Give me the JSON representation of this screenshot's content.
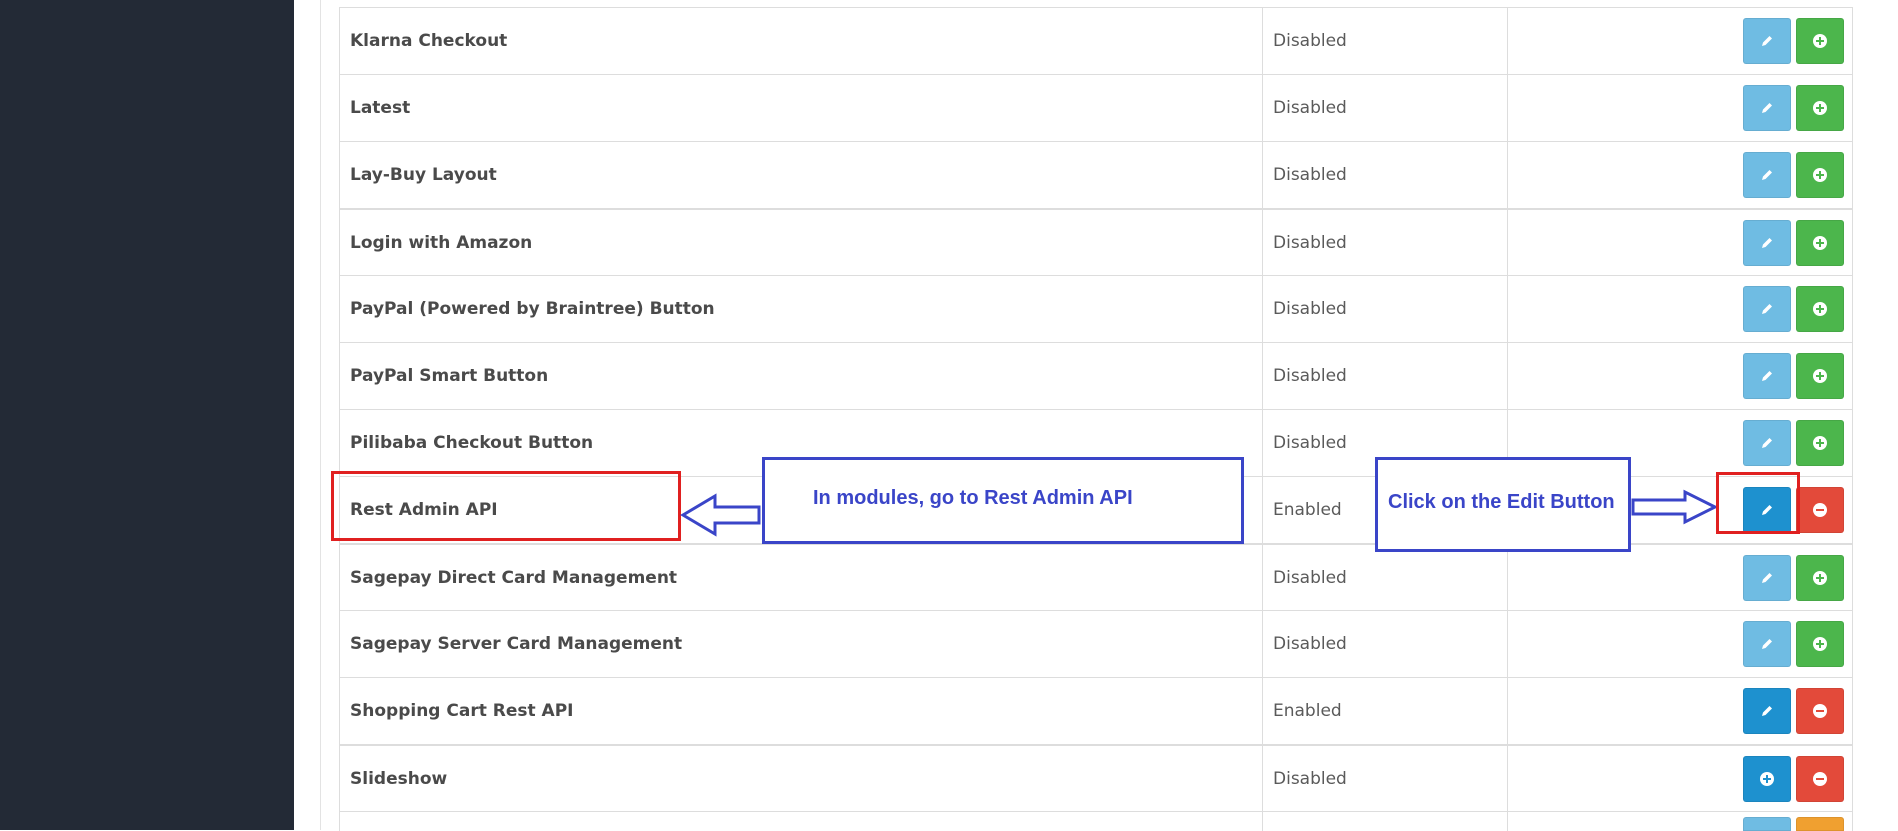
{
  "modules": [
    {
      "name": "Klarna Checkout",
      "status": "Disabled",
      "actions": [
        "edit-dim",
        "install"
      ]
    },
    {
      "name": "Latest",
      "status": "Disabled",
      "actions": [
        "edit-dim",
        "install"
      ]
    },
    {
      "name": "Lay-Buy Layout",
      "status": "Disabled",
      "actions": [
        "edit-dim",
        "install"
      ]
    },
    {
      "name": "Login with Amazon",
      "status": "Disabled",
      "actions": [
        "edit-dim",
        "install"
      ]
    },
    {
      "name": "PayPal (Powered by Braintree) Button",
      "status": "Disabled",
      "actions": [
        "edit-dim",
        "install"
      ]
    },
    {
      "name": "PayPal Smart Button",
      "status": "Disabled",
      "actions": [
        "edit-dim",
        "install"
      ]
    },
    {
      "name": "Pilibaba Checkout Button",
      "status": "Disabled",
      "actions": [
        "edit-dim",
        "install"
      ]
    },
    {
      "name": "Rest Admin API",
      "status": "Enabled",
      "actions": [
        "edit",
        "uninstall"
      ]
    },
    {
      "name": "Sagepay Direct Card Management",
      "status": "Disabled",
      "actions": [
        "edit-dim",
        "install"
      ]
    },
    {
      "name": "Sagepay Server Card Management",
      "status": "Disabled",
      "actions": [
        "edit-dim",
        "install"
      ]
    },
    {
      "name": "Shopping Cart Rest API",
      "status": "Enabled",
      "actions": [
        "edit",
        "uninstall"
      ]
    },
    {
      "name": "Slideshow",
      "status": "Disabled",
      "actions": [
        "install-blue",
        "uninstall"
      ]
    }
  ],
  "annotations": {
    "modules_hint": "In modules, go to Rest Admin API",
    "edit_hint": "Click on the Edit Button"
  },
  "colors": {
    "sidebar": "#232a36",
    "annotation_blue": "#3a45c8",
    "annotation_red": "#e02020",
    "btn_primary": "#1e91cf",
    "btn_success": "#4cb64c",
    "btn_danger": "#e34a3a"
  }
}
